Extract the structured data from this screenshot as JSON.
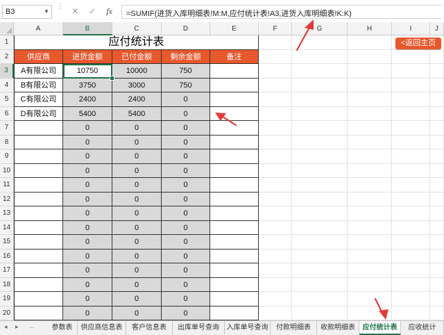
{
  "formula_bar": {
    "name_box": "B3",
    "cancel_icon": "cancel-x-icon",
    "enter_icon": "check-icon",
    "fx_label": "fx",
    "formula": "=SUMIF(进货入库明细表!M:M,应付统计表!A3,进货入库明细表!K:K)"
  },
  "columns": [
    "A",
    "B",
    "C",
    "D",
    "E",
    "F",
    "G",
    "H",
    "I",
    "J"
  ],
  "rows": [
    "1",
    "2",
    "3",
    "4",
    "5",
    "6",
    "7",
    "8",
    "9",
    "10",
    "11",
    "12",
    "13",
    "14",
    "15",
    "16",
    "17",
    "18",
    "19",
    "20"
  ],
  "sheet": {
    "title": "应付统计表",
    "headers": [
      "供应商",
      "进货金额",
      "已付金额",
      "剩余金额",
      "备注"
    ],
    "data": [
      [
        "A有限公司",
        "10750",
        "10000",
        "750",
        ""
      ],
      [
        "B有限公司",
        "3750",
        "3000",
        "750",
        ""
      ],
      [
        "C有限公司",
        "2400",
        "2400",
        "0",
        ""
      ],
      [
        "D有限公司",
        "5400",
        "5400",
        "0",
        ""
      ],
      [
        "",
        "0",
        "0",
        "0",
        ""
      ],
      [
        "",
        "0",
        "0",
        "0",
        ""
      ],
      [
        "",
        "0",
        "0",
        "0",
        ""
      ],
      [
        "",
        "0",
        "0",
        "0",
        ""
      ],
      [
        "",
        "0",
        "0",
        "0",
        ""
      ],
      [
        "",
        "0",
        "0",
        "0",
        ""
      ],
      [
        "",
        "0",
        "0",
        "0",
        ""
      ],
      [
        "",
        "0",
        "0",
        "0",
        ""
      ],
      [
        "",
        "0",
        "0",
        "0",
        ""
      ],
      [
        "",
        "0",
        "0",
        "0",
        ""
      ],
      [
        "",
        "0",
        "0",
        "0",
        ""
      ],
      [
        "",
        "0",
        "0",
        "0",
        ""
      ],
      [
        "",
        "0",
        "0",
        "0",
        ""
      ],
      [
        "",
        "0",
        "0",
        "0",
        ""
      ]
    ]
  },
  "back_button": "<返回主页",
  "tabs": {
    "nav_prev": "◂",
    "nav_next": "▸",
    "more": "...",
    "items": [
      "参数表",
      "供应商信息表",
      "客户信息表",
      "出库单号查询",
      "入库单号查询",
      "付款明细表",
      "收款明细表",
      "应付统计表",
      "应收统计"
    ],
    "active_index": 7
  },
  "colors": {
    "header_orange": "#e8582d",
    "excel_green": "#217346",
    "cell_gray": "#d9d9d9",
    "annotation_red": "#e03c3c"
  }
}
